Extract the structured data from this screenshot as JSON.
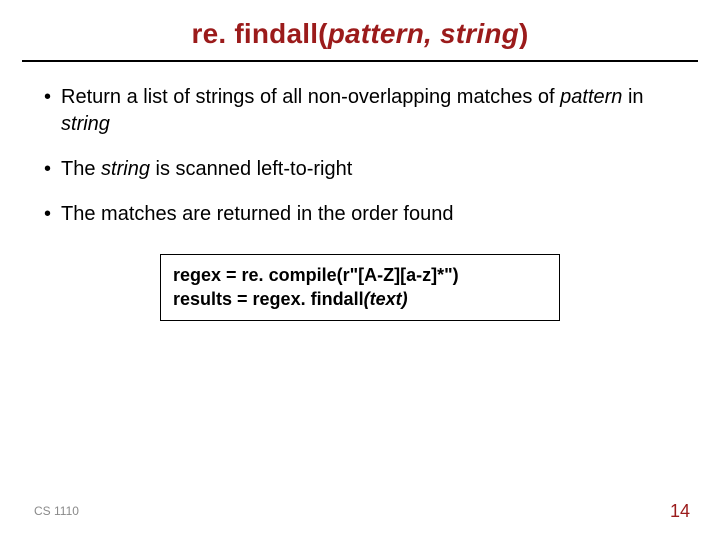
{
  "title": {
    "prefix": "re. findall(",
    "args": "pattern, string",
    "suffix": ")"
  },
  "bullets": {
    "b1": {
      "t1": "Return a list of strings of all non-overlapping matches of ",
      "p": "pattern",
      "t2": " in ",
      "s": "string"
    },
    "b2": {
      "t1": "The ",
      "s": "string",
      "t2": " is scanned left-to-right"
    },
    "b3": {
      "t1": "The matches are returned in the order found"
    }
  },
  "code": {
    "l1a": "regex = re. compile(",
    "l1b": "r\"[A-Z][a-z]*\"",
    "l1c": ")",
    "l2a": "results = regex. findall",
    "l2b": "(text)"
  },
  "footer": {
    "course": "CS 1110",
    "page": "14"
  },
  "colors": {
    "accent": "#9b1b1b"
  }
}
